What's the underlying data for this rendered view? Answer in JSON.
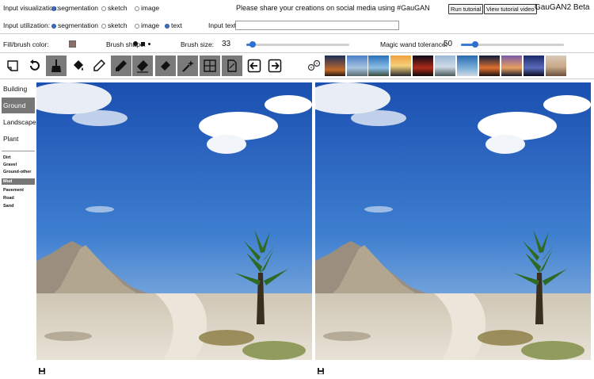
{
  "app": {
    "title": "GauGAN2 Beta",
    "banner": "Please share your creations on social media using #GauGAN"
  },
  "visualization": {
    "label": "Input visualization:",
    "options": [
      "segmentation",
      "sketch",
      "image"
    ],
    "selected": "segmentation"
  },
  "utilization": {
    "label": "Input utilization:",
    "options": [
      "segmentation",
      "sketch",
      "image",
      "text"
    ],
    "selected": [
      "segmentation",
      "text"
    ]
  },
  "input_text": {
    "label": "Input text:",
    "value": ""
  },
  "buttons": {
    "run_tutorial": "Run tutorial",
    "view_tutorial_video": "View tutorial video"
  },
  "brush": {
    "fill_label": "Fill/brush color:",
    "fill_color": "#8a6f6a",
    "shape_label": "Brush shape:",
    "size_label": "Brush size:",
    "size_value": "33",
    "size_fraction": 0.06,
    "wand_label": "Magic wand tolerance:",
    "wand_value": "50",
    "wand_fraction": 0.14
  },
  "tools": [
    "new-canvas-icon",
    "undo-icon",
    "clear-brush-icon",
    "paint-bucket-icon",
    "dropper-icon",
    "pencil-icon",
    "eraser-icon",
    "eraser-small-icon",
    "magic-wand-icon",
    "split-layout-icon",
    "document-icon",
    "arrow-left-icon",
    "arrow-right-icon",
    "dice-icon"
  ],
  "categories": {
    "main": [
      "Building",
      "Ground",
      "Landscape",
      "Plant"
    ],
    "selected_main": "Ground",
    "sub": [
      "Dirt",
      "Gravel",
      "Ground-other",
      "Mud",
      "Pavement",
      "Road",
      "Sand"
    ],
    "selected_sub": "Mud"
  },
  "colors": {
    "accent": "#3b6fc6",
    "selected_bg": "#777777",
    "sky_top": "#1f57b8",
    "sky_bottom": "#8cb6de",
    "ground": "#d8cfbf"
  }
}
